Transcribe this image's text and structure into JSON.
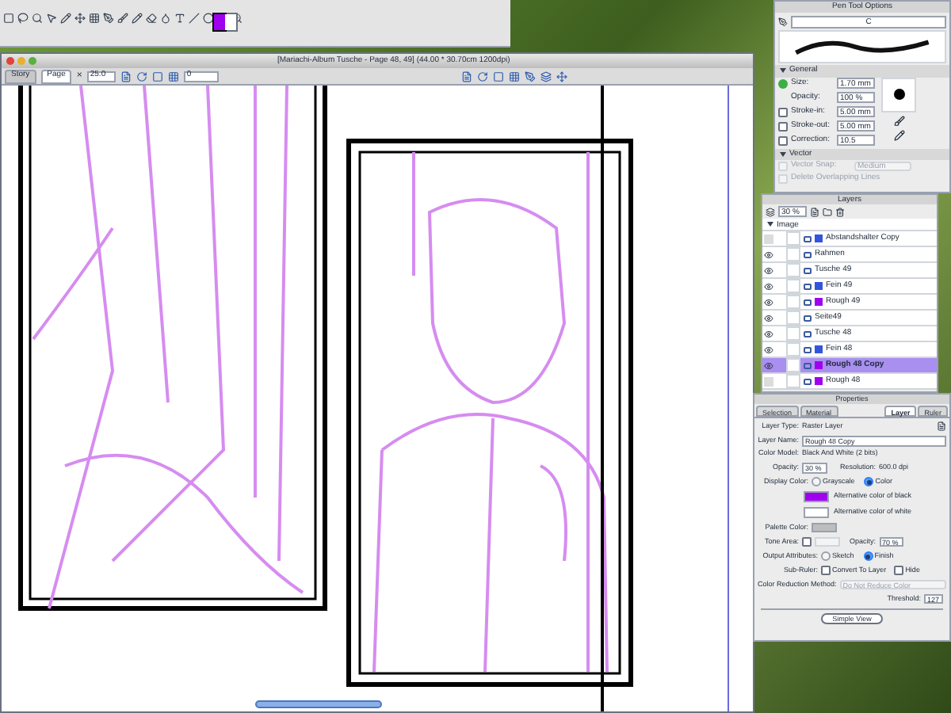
{
  "swatches": [
    {
      "color": "#a000f0",
      "selected": true
    },
    {
      "color": "#ffffff",
      "selected": false
    }
  ],
  "document": {
    "title": "[Mariachi-Album Tusche - Page 48, 49] (44.00 * 30.70cm 1200dpi)",
    "tabs": [
      {
        "label": "Story",
        "selected": false
      },
      {
        "label": "Page",
        "selected": true
      }
    ],
    "close": "×",
    "zoom": "25.0",
    "rotation": "0"
  },
  "pen_tool_options": {
    "title": "Pen Tool Options",
    "preset": "C",
    "general": "General",
    "settings": [
      {
        "kind": "dot",
        "label": "Size:",
        "value": "1.70 mm",
        "checked": true
      },
      {
        "kind": "plain",
        "label": "Opacity:",
        "value": "100 %"
      },
      {
        "kind": "checkbox",
        "label": "Stroke-in:",
        "value": "5.00 mm",
        "checked": false
      },
      {
        "kind": "checkbox",
        "label": "Stroke-out:",
        "value": "5.00 mm",
        "checked": false
      },
      {
        "kind": "checkbox",
        "label": "Correction:",
        "value": "10.5",
        "checked": false
      }
    ],
    "vector": "Vector",
    "vector_snap": {
      "label": "Vector Snap:",
      "value": "Medium",
      "disabled": true
    },
    "delete_overlapping": {
      "label": "Delete Overlapping Lines",
      "disabled": true
    }
  },
  "layers": {
    "title": "Layers",
    "opacity": "30 %",
    "group": "Image",
    "items": [
      {
        "name": "Abstandshalter Copy",
        "visible": false,
        "color": "#3355dd",
        "selected": false
      },
      {
        "name": "Rahmen",
        "visible": true,
        "selected": false
      },
      {
        "name": "Tusche 49",
        "visible": true,
        "selected": false
      },
      {
        "name": "Fein 49",
        "visible": true,
        "color": "#3355dd",
        "selected": false
      },
      {
        "name": "Rough 49",
        "visible": true,
        "color": "#a000f0",
        "selected": false
      },
      {
        "name": "Seite49",
        "visible": true,
        "selected": false
      },
      {
        "name": "Tusche 48",
        "visible": true,
        "selected": false
      },
      {
        "name": "Fein 48",
        "visible": true,
        "color": "#3355dd",
        "selected": false
      },
      {
        "name": "Rough 48 Copy",
        "visible": true,
        "color": "#a000f0",
        "selected": true
      },
      {
        "name": "Rough 48",
        "visible": false,
        "color": "#a000f0",
        "selected": false
      }
    ]
  },
  "properties": {
    "title": "Properties",
    "tabs": [
      {
        "label": "Selection",
        "selected": false
      },
      {
        "label": "Material",
        "selected": false
      },
      {
        "label": "Layer",
        "selected": true
      },
      {
        "label": "Ruler",
        "selected": false
      }
    ],
    "layer_type": {
      "label": "Layer Type:",
      "value": "Raster Layer"
    },
    "layer_name": {
      "label": "Layer Name:",
      "value": "Rough 48 Copy"
    },
    "color_model": {
      "label": "Color Model:",
      "value": "Black And White (2 bits)"
    },
    "opacity": {
      "label": "Opacity:",
      "value": "30 %"
    },
    "resolution": {
      "label": "Resolution:",
      "value": "600.0 dpi"
    },
    "display_color": {
      "label": "Display Color:",
      "options": [
        {
          "label": "Grayscale",
          "selected": false
        },
        {
          "label": "Color",
          "selected": true
        }
      ]
    },
    "alt_black": {
      "label": "Alternative color of black",
      "color": "#a000f0"
    },
    "alt_white": {
      "label": "Alternative color of white",
      "color": "#ffffff"
    },
    "palette_color": {
      "label": "Palette Color:"
    },
    "tone_area": {
      "label": "Tone Area:",
      "checked": false,
      "opacity_label": "Opacity:",
      "opacity": "70 %"
    },
    "output_attributes": {
      "label": "Output Attributes:",
      "options": [
        {
          "label": "Sketch",
          "selected": false
        },
        {
          "label": "Finish",
          "selected": true
        }
      ]
    },
    "sub_ruler": {
      "label": "Sub-Ruler:",
      "options": [
        {
          "label": "Convert To Layer",
          "checked": false
        },
        {
          "label": "Hide",
          "checked": false
        }
      ]
    },
    "color_reduction": {
      "label": "Color Reduction Method:",
      "value": "Do Not Reduce Color"
    },
    "threshold": {
      "label": "Threshold:",
      "value": "127"
    },
    "simple_view": "Simple View"
  }
}
